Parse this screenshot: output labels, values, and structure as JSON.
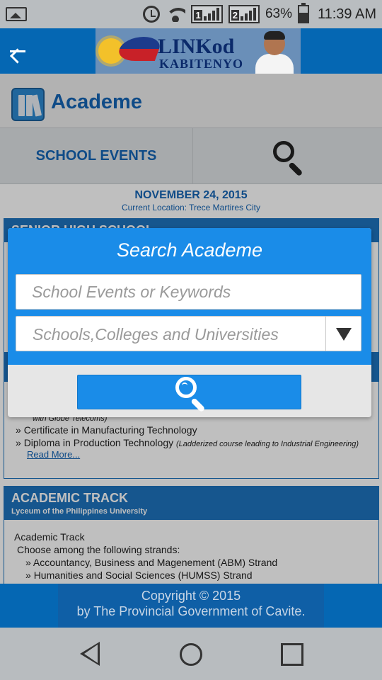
{
  "status_bar": {
    "battery": "63%",
    "time": "11:39 AM",
    "sim1": "1",
    "sim2": "2"
  },
  "header": {
    "logo_title": "LINKod",
    "logo_subtitle": "KABITENYO"
  },
  "page": {
    "title": "Academe"
  },
  "tabs": {
    "events_label": "SCHOOL EVENTS"
  },
  "content": {
    "date": "NOVEMBER 24, 2015",
    "location": "Current Location: Trece Martires City",
    "card1_title": "SENIOR HIGH SCHOOL",
    "card2_items": [
      {
        "text": "with Globe Telecoms)"
      },
      {
        "text": "Certificate in Manufacturing Technology"
      },
      {
        "text": "Diploma in Production Technology",
        "note": "(Ladderized course leading to Industrial Engineering)"
      }
    ],
    "read_more": "Read More...",
    "card3": {
      "title": "ACADEMIC TRACK",
      "subtitle": "Lyceum of the Philippines University",
      "line1": "Academic Track",
      "line2": "Choose among the following strands:",
      "strands": [
        "Accountancy, Business and Magenement (ABM) Strand",
        "Humanities and Social Sciences (HUMSS) Strand"
      ]
    }
  },
  "modal": {
    "title": "Search Academe",
    "search_placeholder": "School Events or Keywords",
    "select_value": "Schools,Colleges and Universities"
  },
  "footer": {
    "line1": "Copyright © 2015",
    "line2": "by The Provincial Government of Cavite."
  },
  "colors": {
    "header_blue": "#0567b3",
    "modal_blue": "#1a8ce8",
    "title_blue": "#1565b5"
  },
  "icons": [
    "image-icon",
    "alarm-icon",
    "wifi-icon",
    "battery-icon",
    "back-arrow-icon",
    "books-icon",
    "search-icon",
    "dropdown-arrow-icon",
    "nav-back-icon",
    "nav-home-icon",
    "nav-recents-icon"
  ]
}
